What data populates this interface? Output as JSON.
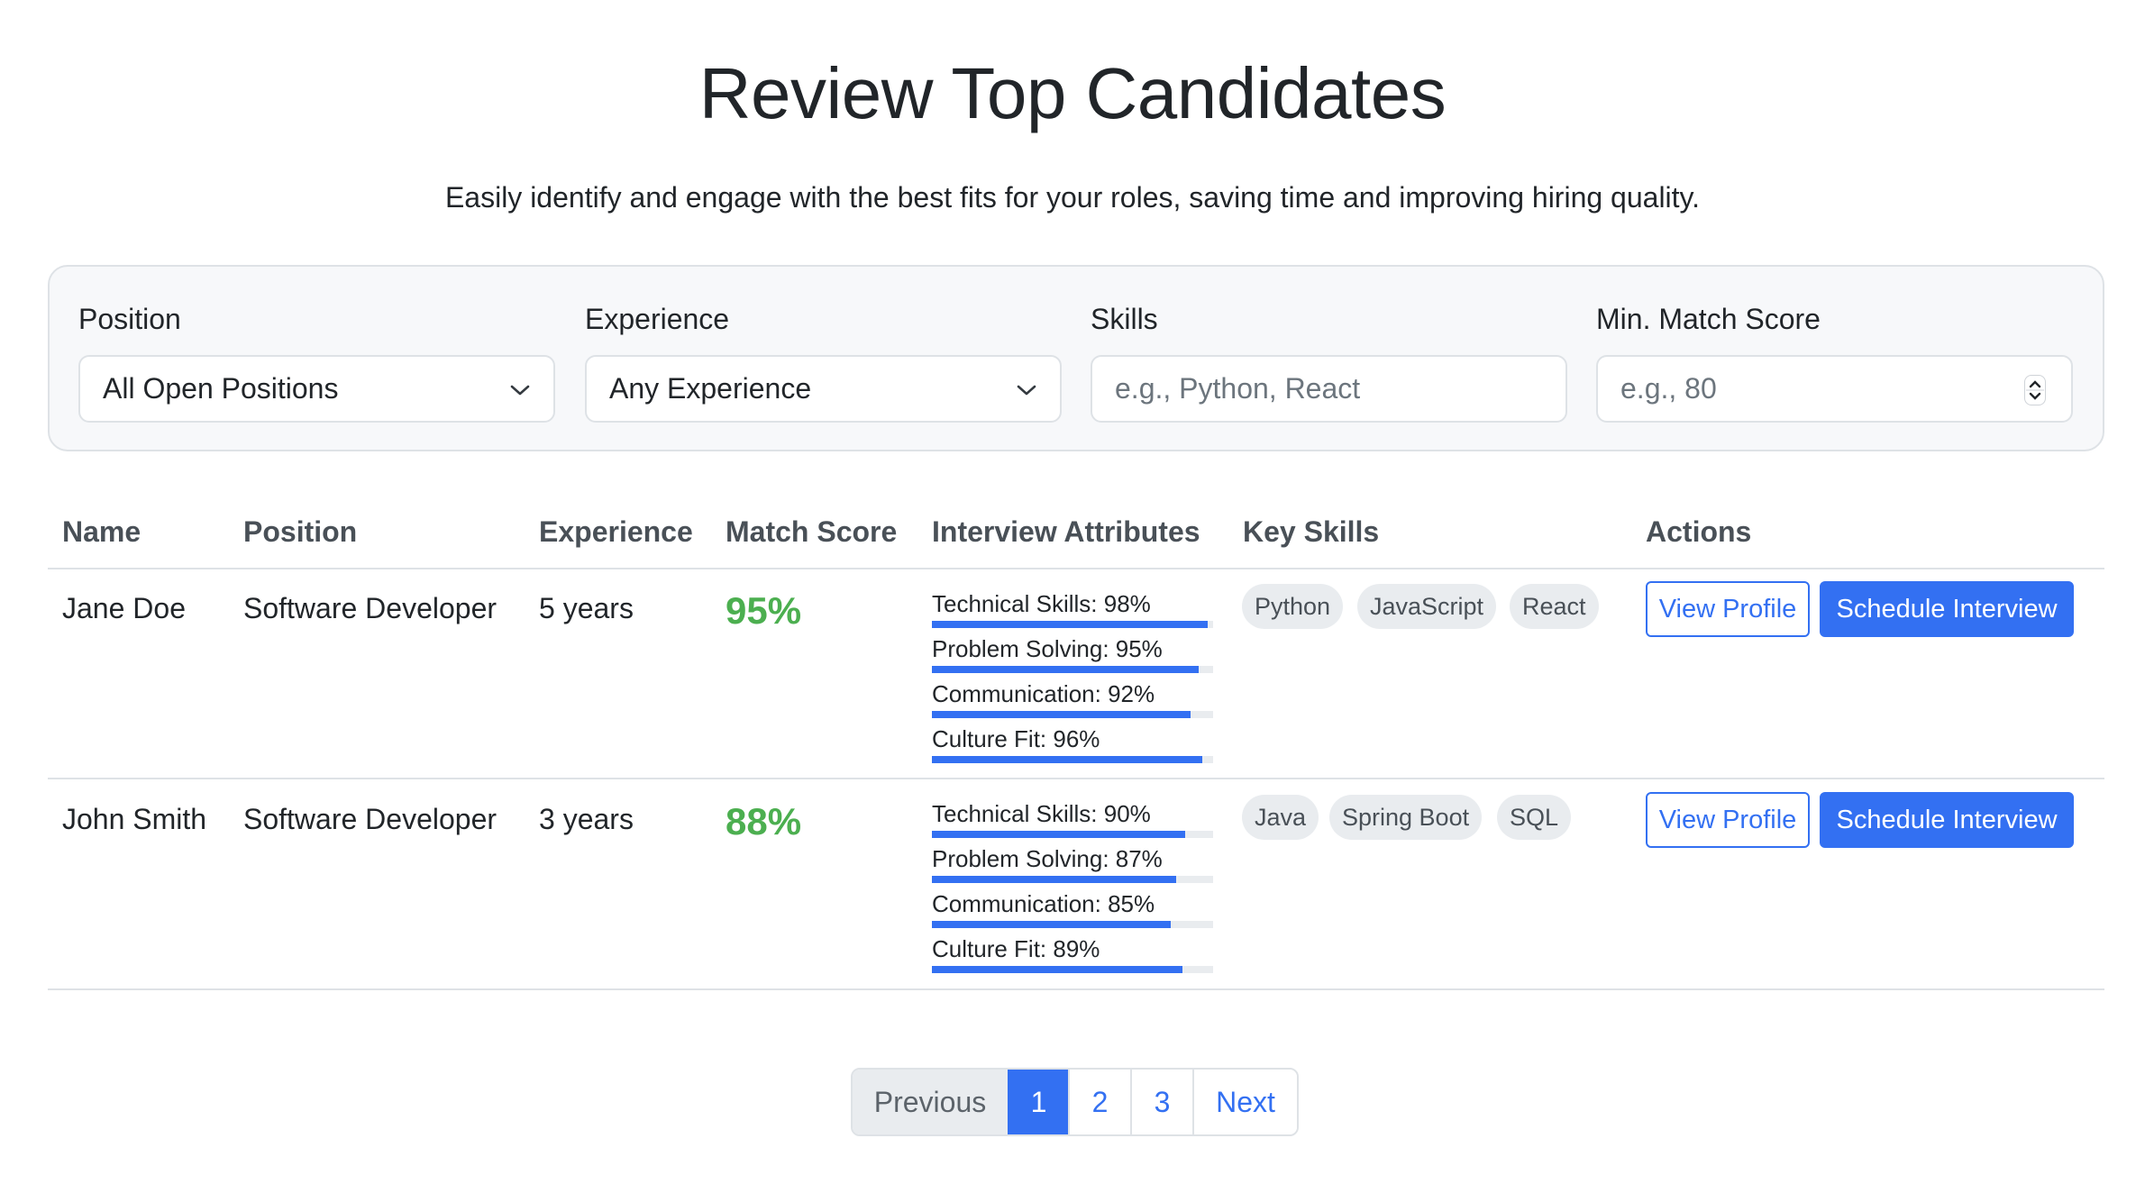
{
  "header": {
    "title": "Review Top Candidates",
    "subtitle": "Easily identify and engage with the best fits for your roles, saving time and improving hiring quality."
  },
  "filters": {
    "position": {
      "label": "Position",
      "value": "All Open Positions",
      "icon": "chevron-down-icon"
    },
    "experience": {
      "label": "Experience",
      "value": "Any Experience",
      "icon": "chevron-down-icon"
    },
    "skills": {
      "label": "Skills",
      "placeholder": "e.g., Python, React",
      "value": ""
    },
    "min_score": {
      "label": "Min. Match Score",
      "placeholder": "e.g., 80",
      "value": "",
      "icon": "number-spinner-icon"
    }
  },
  "table": {
    "columns": [
      "Name",
      "Position",
      "Experience",
      "Match Score",
      "Interview Attributes",
      "Key Skills",
      "Actions"
    ],
    "rows": [
      {
        "name": "Jane Doe",
        "position": "Software Developer",
        "experience": "5 years",
        "match_score": "95%",
        "attributes": [
          {
            "label": "Technical Skills: 98%",
            "value": 98
          },
          {
            "label": "Problem Solving: 95%",
            "value": 95
          },
          {
            "label": "Communication: 92%",
            "value": 92
          },
          {
            "label": "Culture Fit: 96%",
            "value": 96
          }
        ],
        "skills": [
          "Python",
          "JavaScript",
          "React"
        ],
        "actions": {
          "view": "View Profile",
          "schedule": "Schedule Interview"
        }
      },
      {
        "name": "John Smith",
        "position": "Software Developer",
        "experience": "3 years",
        "match_score": "88%",
        "attributes": [
          {
            "label": "Technical Skills: 90%",
            "value": 90
          },
          {
            "label": "Problem Solving: 87%",
            "value": 87
          },
          {
            "label": "Communication: 85%",
            "value": 85
          },
          {
            "label": "Culture Fit: 89%",
            "value": 89
          }
        ],
        "skills": [
          "Java",
          "Spring Boot",
          "SQL"
        ],
        "actions": {
          "view": "View Profile",
          "schedule": "Schedule Interview"
        }
      }
    ]
  },
  "pagination": {
    "previous": "Previous",
    "pages": [
      "1",
      "2",
      "3"
    ],
    "current": "1",
    "next": "Next"
  },
  "colors": {
    "primary": "#3370f2",
    "score_green": "#4caf50",
    "chip_bg": "#e9ecef"
  }
}
